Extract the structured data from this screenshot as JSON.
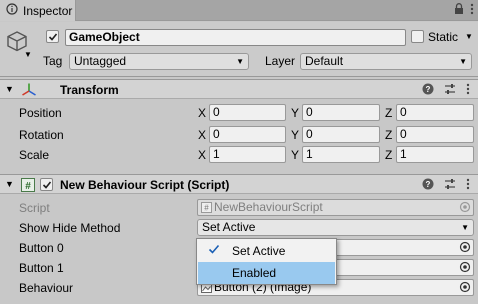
{
  "tab": {
    "label": "Inspector"
  },
  "gameobject": {
    "name": "GameObject",
    "active": true,
    "static_label": "Static",
    "static": false,
    "tag_label": "Tag",
    "tag_value": "Untagged",
    "layer_label": "Layer",
    "layer_value": "Default"
  },
  "transform": {
    "title": "Transform",
    "rows": [
      {
        "label": "Position",
        "x": "0",
        "y": "0",
        "z": "0"
      },
      {
        "label": "Rotation",
        "x": "0",
        "y": "0",
        "z": "0"
      },
      {
        "label": "Scale",
        "x": "1",
        "y": "1",
        "z": "1"
      }
    ],
    "axes": {
      "x": "X",
      "y": "Y",
      "z": "Z"
    }
  },
  "script_component": {
    "title": "New Behaviour Script (Script)",
    "enabled": true,
    "script_label": "Script",
    "script_value": "NewBehaviourScript",
    "hide_method_label": "Show Hide Method",
    "hide_method_value": "Set Active",
    "button0_label": "Button 0",
    "button1_label": "Button 1",
    "behaviour_label": "Behaviour",
    "behaviour_value": "Button (2) (Image)"
  },
  "popup": {
    "items": [
      {
        "label": "Set Active",
        "checked": true
      },
      {
        "label": "Enabled",
        "highlighted": true
      }
    ]
  },
  "colors": {
    "background": "#c8c8c8",
    "highlight": "#99c9ef"
  }
}
